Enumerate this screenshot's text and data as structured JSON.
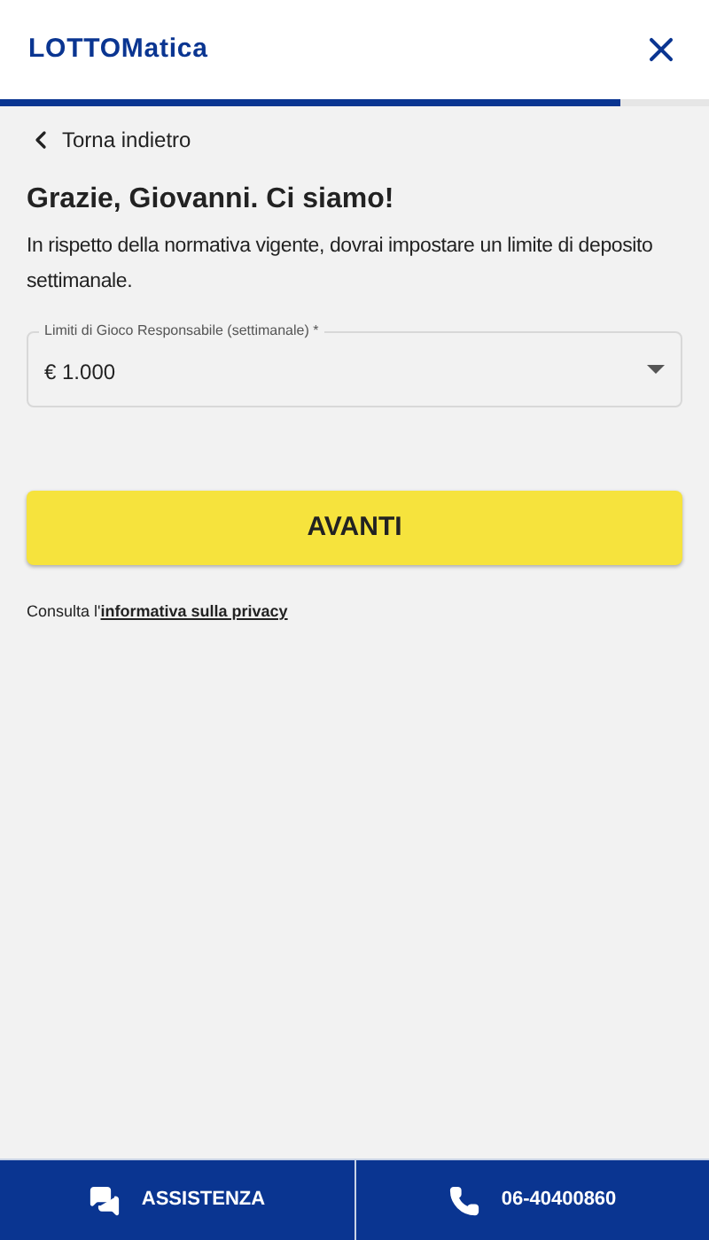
{
  "header": {
    "logo": "LOTTOMatica"
  },
  "progress": {
    "level": 0.875
  },
  "back_link": "Torna indietro",
  "title": "Grazie, Giovanni. Ci siamo!",
  "description": "In rispetto della normativa vigente, dovrai impostare un limite di deposito settimanale.",
  "select": {
    "label": "Limiti di Gioco Responsabile (settimanale) *",
    "value": "€ 1.000"
  },
  "primary_button": "AVANTI",
  "privacy": {
    "text": "Consulta l'",
    "link": "informativa sulla privacy"
  },
  "footer": [
    {
      "kind": "chat",
      "label": "ASSISTENZA"
    },
    {
      "kind": "phone",
      "label": "06-40400860"
    }
  ]
}
